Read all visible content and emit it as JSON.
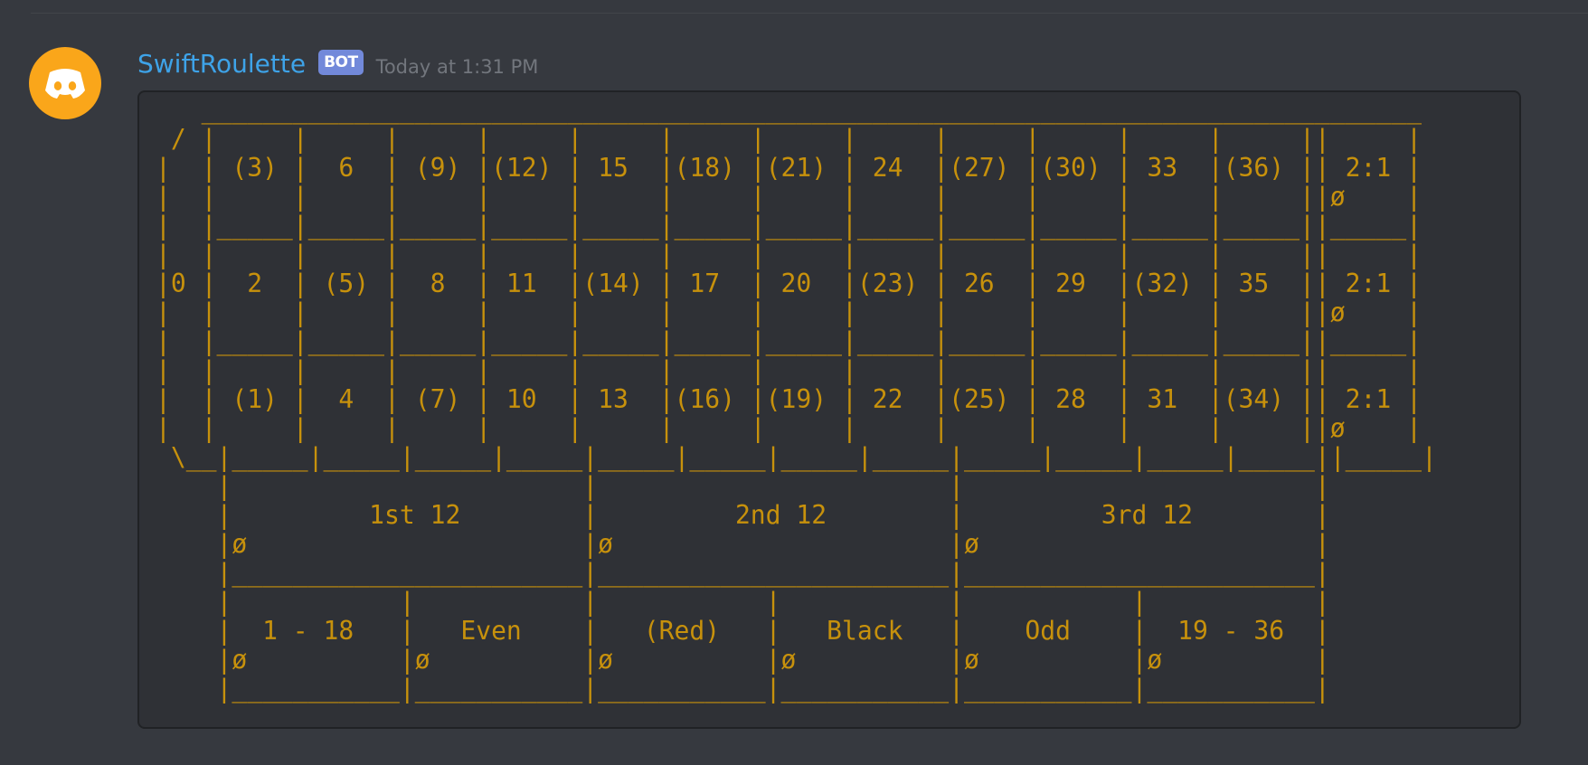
{
  "message": {
    "author": "SwiftRoulette",
    "bot_tag": "BOT",
    "timestamp": "Today at 1:31 PM",
    "avatar_icon": "discord-logo-icon",
    "colors": {
      "background": "#36393f",
      "code_block_background": "#2f3136",
      "code_text": "#c7910c",
      "username": "#3ea3e8",
      "bot_tag_background": "#7289da",
      "timestamp": "#72767d",
      "avatar_background": "#faa61a"
    },
    "table_ascii": "   ________________________________________________________________________________\n / |     |     |     |     |     |     |     |     |     |     |     |     ||     |\n|  | (3) |  6  | (9) |(12) | 15  |(18) |(21) | 24  |(27) |(30) | 33  |(36) || 2:1 |\n|  |     |     |     |     |     |     |     |     |     |     |     |     ||ø    |\n|  |_____|_____|_____|_____|_____|_____|_____|_____|_____|_____|_____|_____||_____|\n|  |     |     |     |     |     |     |     |     |     |     |     |     ||     |\n|0 |  2  | (5) |  8  | 11  |(14) | 17  | 20  |(23) | 26  | 29  |(32) | 35  || 2:1 |\n|  |     |     |     |     |     |     |     |     |     |     |     |     ||ø    |\n|  |_____|_____|_____|_____|_____|_____|_____|_____|_____|_____|_____|_____||_____|\n|  |     |     |     |     |     |     |     |     |     |     |     |     ||     |\n|  | (1) |  4  | (7) | 10  | 13  |(16) |(19) | 22  |(25) | 28  | 31  |(34) || 2:1 |\n|  |     |     |     |     |     |     |     |     |     |     |     |     ||ø    |\n \\__|_____|_____|_____|_____|_____|_____|_____|_____|_____|_____|_____|_____||_____|\n    |                       |                       |                       |\n    |         1st 12        |         2nd 12        |         3rd 12        |\n    |ø                      |ø                      |ø                      |\n    |_______________________|_______________________|_______________________|\n    |           |           |           |           |           |           |\n    |  1 - 18   |   Even    |   (Red)   |   Black   |    Odd    |  19 - 36  |\n    |ø          |ø          |ø          |ø          |ø          |ø          |\n    |___________|___________|___________|___________|___________|___________|"
  }
}
